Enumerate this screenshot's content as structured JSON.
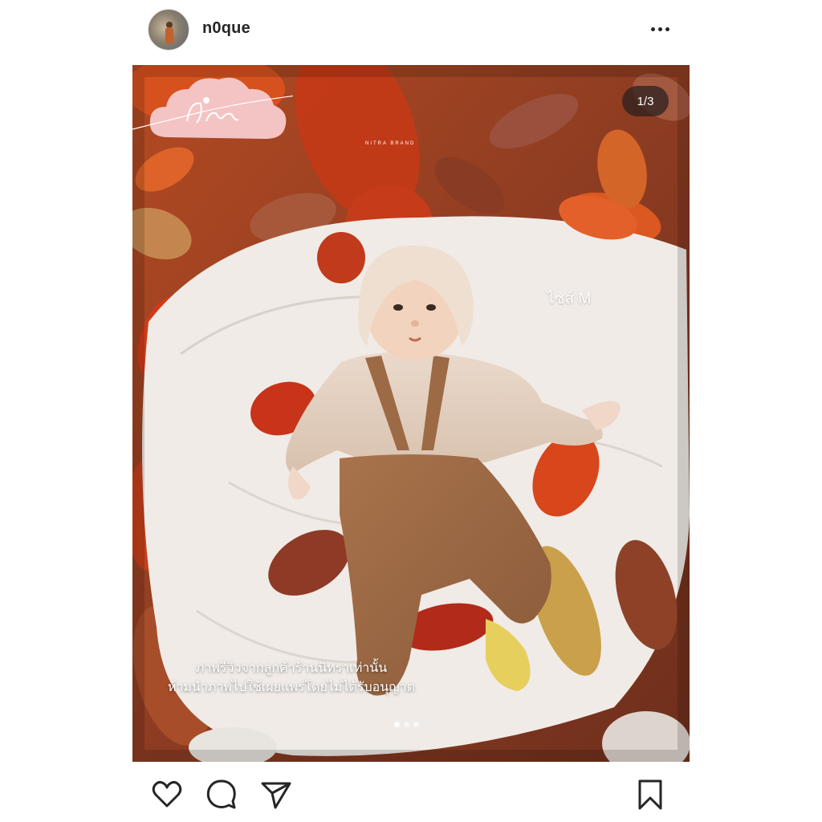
{
  "post": {
    "username": "n0que",
    "avatar_icon": "profile-avatar",
    "more_icon": "more-horizontal-icon"
  },
  "media": {
    "counter": "1/3",
    "size_text": "ไซส์ M",
    "caption_line1": "ภาพรีวิวจากลูกค้าร้านนิทราเท่านั้น",
    "caption_line2": "ห้ามนำภาพไปใช้เผยแพร่โดยไม่ได้รับอนุญาต",
    "brand_subtext": "NITRA BRAND",
    "brand_mark": "Nitra",
    "carousel_total": 3,
    "carousel_active": 0
  },
  "actions": {
    "like_icon": "heart-icon",
    "comment_icon": "comment-icon",
    "share_icon": "send-icon",
    "save_icon": "bookmark-icon"
  },
  "colors": {
    "text": "#262626",
    "logo_cloud": "#f4c4c4",
    "counter_bg": "rgba(40,30,30,0.72)"
  }
}
